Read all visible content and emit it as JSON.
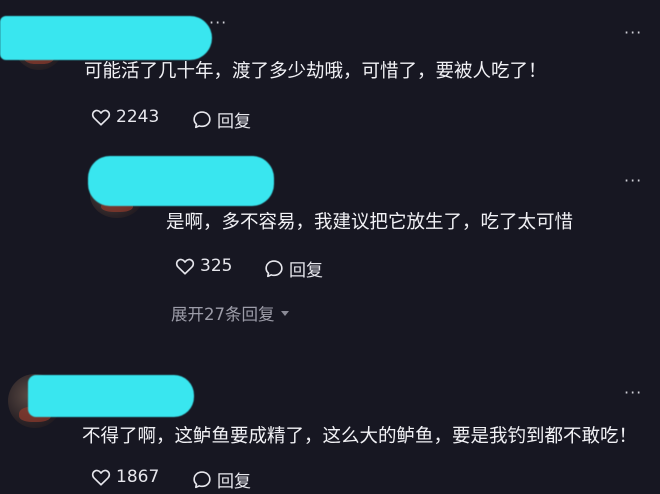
{
  "comments": [
    {
      "text": "可能活了几十年，渡了多少劫哦，可惜了，要被人吃了！",
      "likes": "2243",
      "reply_label": "回复",
      "more_icon": "more-dots-icon"
    },
    {
      "text": "是啊，多不容易，我建议把它放生了，吃了太可惜",
      "likes": "325",
      "reply_label": "回复",
      "more_icon": "more-dots-icon",
      "expand_label": "展开27条回复"
    },
    {
      "text": "不得了啊，这鲈鱼要成精了，这么大的鲈鱼，要是我钓到都不敢吃！",
      "likes": "1867",
      "reply_label": "回复",
      "more_icon": "more-dots-icon"
    }
  ],
  "colors": {
    "background": "#171722",
    "redaction": "#39e6ef",
    "text": "#f1f1f5",
    "muted": "#9d9da9"
  }
}
